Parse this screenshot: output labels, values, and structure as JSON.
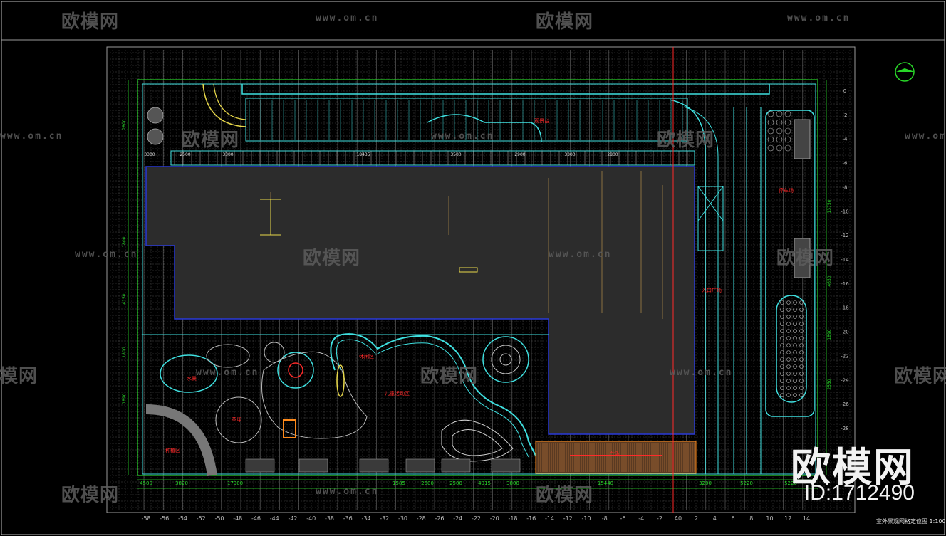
{
  "watermark": {
    "logo_text": "欧模网",
    "url_text": "www.om.cn",
    "brand": "欧模网",
    "id_text": "ID:1712490"
  },
  "drawing": {
    "title": "室外景观网格定位图",
    "scale": "1:100",
    "zone_labels": [
      "入口广场",
      "水景",
      "休闲区",
      "儿童活动区",
      "草坪",
      "种植区",
      "观景台",
      "停车场",
      "广场"
    ],
    "bottom_axis": [
      "-58",
      "-56",
      "-54",
      "-52",
      "-50",
      "-48",
      "-46",
      "-44",
      "-42",
      "-40",
      "-38",
      "-36",
      "-34",
      "-32",
      "-30",
      "-28",
      "-26",
      "-24",
      "-22",
      "-20",
      "-18",
      "-16",
      "-14",
      "-12",
      "-10",
      "-8",
      "-6",
      "-4",
      "-2",
      "A0",
      "2",
      "4",
      "6",
      "8",
      "10",
      "12",
      "14"
    ],
    "right_axis": [
      "0",
      "-2",
      "-4",
      "-6",
      "-8",
      "-10",
      "-12",
      "-14",
      "-16",
      "-18",
      "-20",
      "-22",
      "-24",
      "-26",
      "-28"
    ],
    "bottom_dims": [
      "4500",
      "3820",
      "17900",
      "1585",
      "2600",
      "2500",
      "4015",
      "3800",
      "15440",
      "3200",
      "5220",
      "5220"
    ],
    "top_dims": [
      "3300",
      "2500",
      "3300",
      "18435",
      "3500",
      "2900",
      "3300",
      "2800"
    ],
    "left_dims": [
      "2800",
      "1800",
      "4150",
      "1800",
      "1890"
    ],
    "right_dims": [
      "13750",
      "4650",
      "1890",
      "2550"
    ]
  },
  "colors": {
    "background": "#000000",
    "grid": "#4a4a4a",
    "cyan": "#3fe0e0",
    "green": "#28d628",
    "yellow": "#e8d84a",
    "red": "#ff2a2a",
    "orange": "#ff8a1a",
    "blue": "#2a3ad8",
    "building": "#2e2e2e"
  }
}
